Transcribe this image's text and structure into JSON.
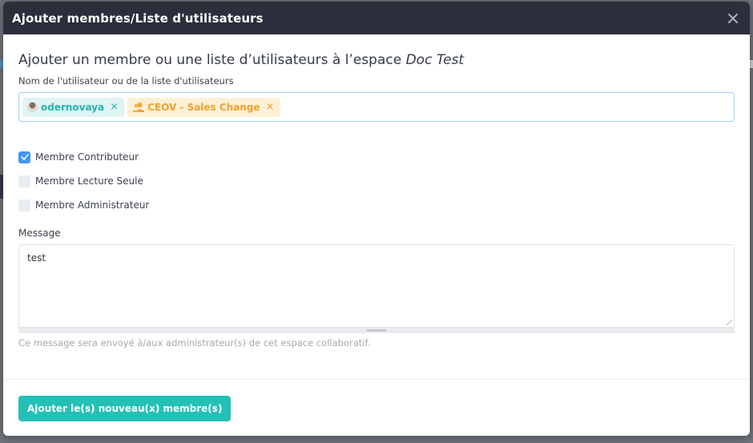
{
  "modal": {
    "title": "Ajouter membres/Liste d'utilisateurs",
    "close_icon": "close-icon"
  },
  "form": {
    "heading_prefix": "Ajouter un membre ou une liste d’utilisateurs à l’espace ",
    "heading_space": "Doc Test",
    "users_label": "Nom de l'utilisateur ou de la liste d'utilisateurs",
    "tags": [
      {
        "label": "odernovaya",
        "icon": "avatar-icon",
        "remove": "×"
      },
      {
        "label": "CEOV - Sales Change",
        "icon": "group-icon",
        "remove": "×"
      }
    ],
    "roles": [
      {
        "label": "Membre Contributeur",
        "checked": true
      },
      {
        "label": "Membre Lecture Seule",
        "checked": false
      },
      {
        "label": "Membre Administrateur",
        "checked": false
      }
    ],
    "message_label": "Message",
    "message_value": "test",
    "message_help": "Ce message sera envoyé à/aux administrateur(s) de cet espace collaboratif."
  },
  "footer": {
    "submit_label": "Ajouter le(s) nouveau(x) membre(s)"
  },
  "colors": {
    "header_bg": "#2a2f3b",
    "primary": "#24c0b6",
    "checkbox_checked": "#3f96f0",
    "tag_user_text": "#26b5b0",
    "tag_group_text": "#f0a12b"
  }
}
